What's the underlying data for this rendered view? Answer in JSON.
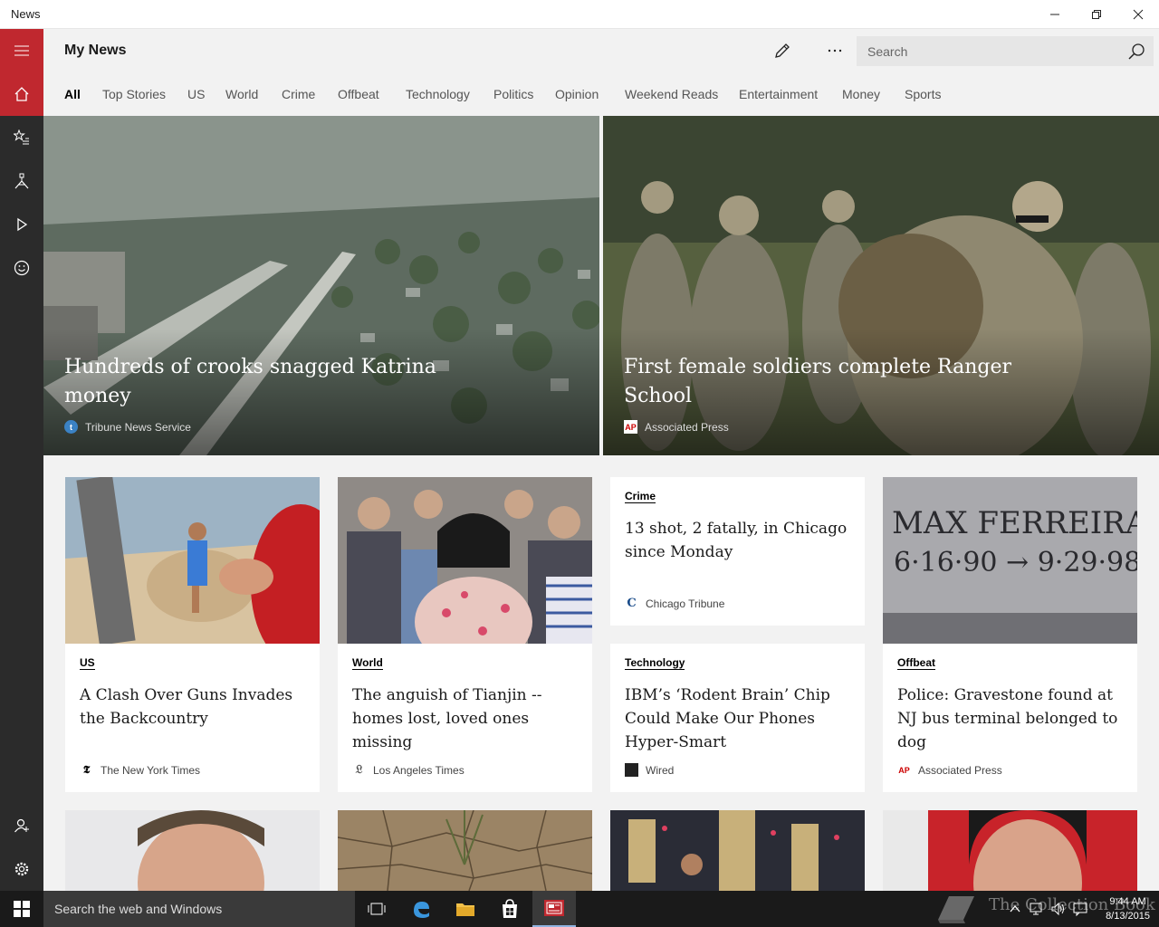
{
  "window": {
    "title": "News"
  },
  "header": {
    "page_title": "My News",
    "search_placeholder": "Search"
  },
  "tabs": [
    "All",
    "Top Stories",
    "US",
    "World",
    "Crime",
    "Offbeat",
    "Technology",
    "Politics",
    "Opinion",
    "Weekend Reads",
    "Entertainment",
    "Money",
    "Sports"
  ],
  "active_tab": "All",
  "hero": [
    {
      "title": "Hundreds of crooks snagged Katrina money",
      "source": "Tribune News Service"
    },
    {
      "title": "First female soldiers complete Ranger School",
      "source": "Associated Press",
      "source_badge": "AP"
    }
  ],
  "cards": [
    {
      "category": "US",
      "title": "A Clash Over Guns Invades the Backcountry",
      "source": "The New York Times"
    },
    {
      "category": "World",
      "title": "The anguish of Tianjin -- homes lost, loved ones missing",
      "source": "Los Angeles Times"
    },
    {
      "category": "Crime",
      "title": "13 shot, 2 fatally, in Chicago since Monday",
      "source": "Chicago Tribune"
    },
    {
      "category": "Technology",
      "title": "IBM’s ‘Rodent Brain’ Chip Could Make Our Phones Hyper-Smart",
      "source": "Wired"
    },
    {
      "category": "Offbeat",
      "title": "Police: Gravestone found at NJ bus terminal belonged to dog",
      "source": "Associated Press",
      "source_badge": "AP"
    }
  ],
  "gravestone": {
    "line1": "MAX FERREIRA",
    "line2": "6·16·90 → 9·29·98"
  },
  "taskbar": {
    "search_placeholder": "Search the web and Windows",
    "time": "9:44 AM",
    "date": "8/13/2015",
    "watermark": "The Collection Book"
  },
  "accent": "#c0282f"
}
